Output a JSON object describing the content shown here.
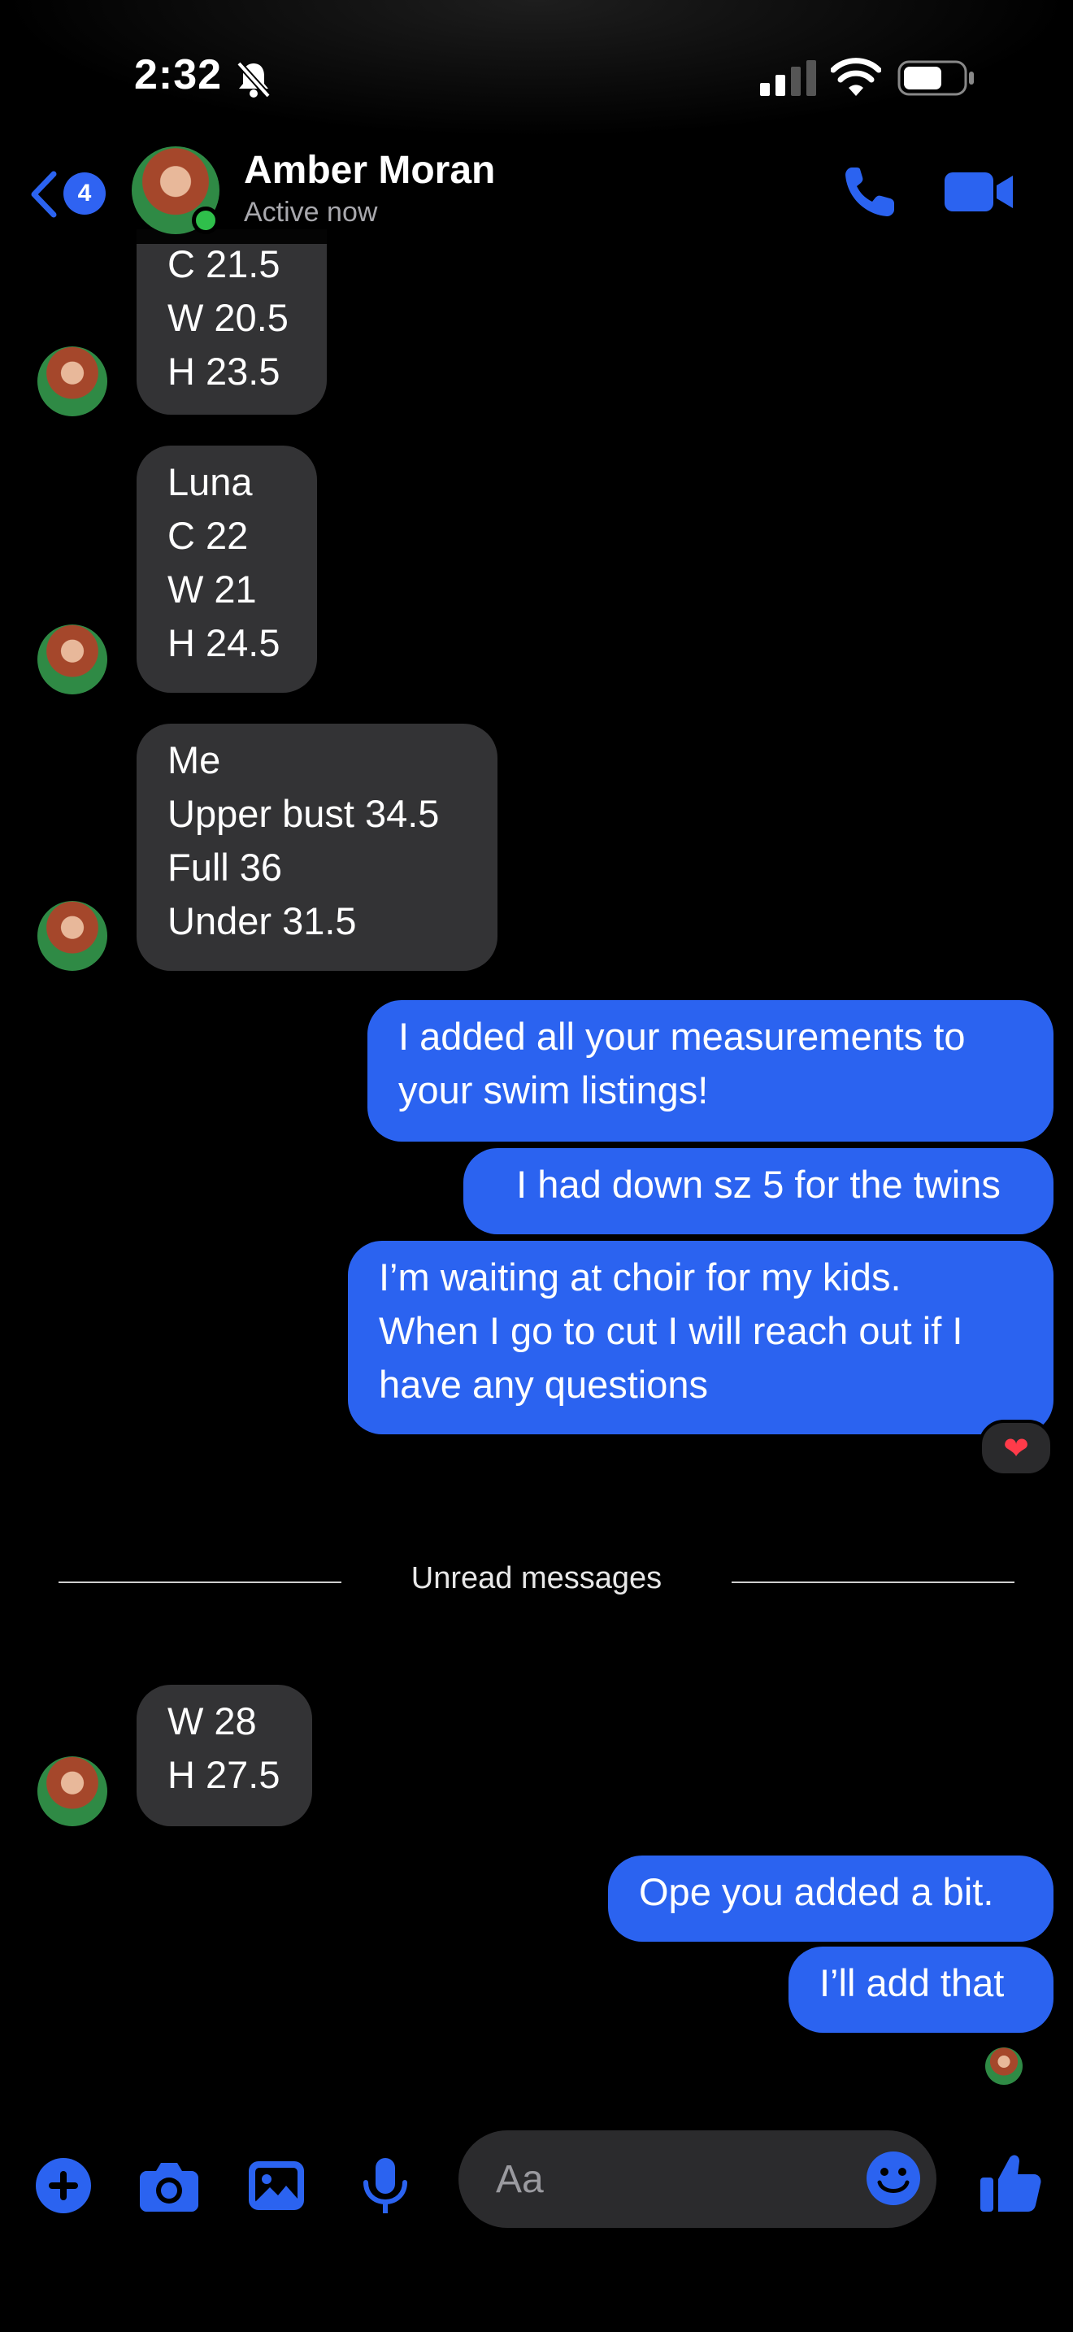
{
  "status_bar": {
    "time": "2:32"
  },
  "header": {
    "unread_count": "4",
    "contact_name": "Amber Moran",
    "presence": "Active now"
  },
  "messages": [
    {
      "from": "contact",
      "lines": [
        "C 21.5",
        "W 20.5",
        "H 23.5"
      ]
    },
    {
      "from": "contact",
      "lines": [
        "Luna",
        "C 22",
        "W 21",
        "H 24.5"
      ]
    },
    {
      "from": "contact",
      "lines": [
        "Me",
        "Upper bust 34.5",
        "Full 36",
        "Under 31.5"
      ]
    },
    {
      "from": "me",
      "lines": [
        "I added all your measurements to",
        "your swim listings!"
      ]
    },
    {
      "from": "me",
      "lines": [
        "I had down sz 5 for the twins"
      ]
    },
    {
      "from": "me",
      "lines": [
        "I’m waiting at choir for my kids.",
        "When I go to cut I will reach out if I",
        "have any questions"
      ],
      "reaction": "❤"
    },
    {
      "from": "contact",
      "lines": [
        "W 28",
        "H 27.5"
      ]
    },
    {
      "from": "me",
      "lines": [
        "Ope you added a bit."
      ]
    },
    {
      "from": "me",
      "lines": [
        "I’ll add that"
      ]
    }
  ],
  "divider": {
    "label": "Unread messages"
  },
  "composer": {
    "placeholder": "Aa",
    "icons": [
      "plus-icon",
      "camera-icon",
      "gallery-icon",
      "microphone-icon",
      "emoji-icon",
      "thumbs-up-icon"
    ]
  },
  "colors": {
    "accent": "#2b63f0",
    "incoming_bubble": "#333335",
    "online": "#2fbf4b"
  }
}
